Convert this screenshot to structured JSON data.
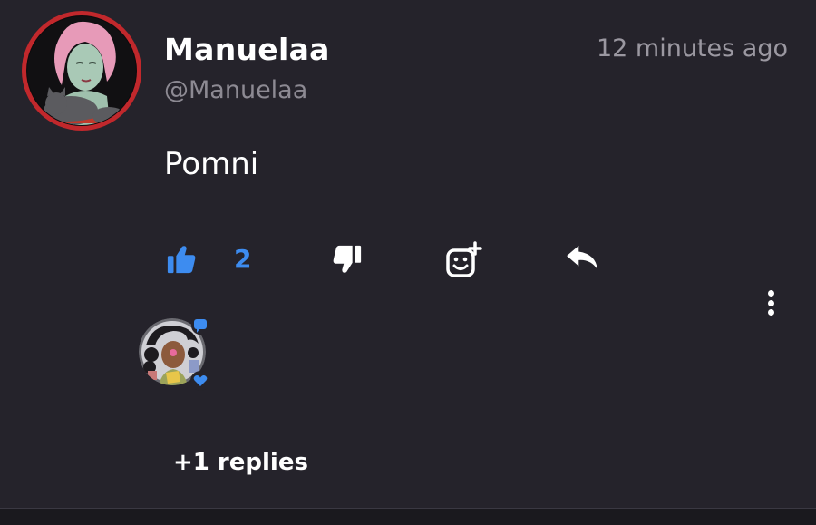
{
  "comment": {
    "author_name": "Manuelaa",
    "author_handle": "@Manuelaa",
    "timestamp": "12 minutes ago",
    "text": "Pomni",
    "likes": "2",
    "replies_link": "+1 replies"
  },
  "icons": {
    "like": "thumbs-up-icon",
    "dislike": "thumbs-down-icon",
    "react": "add-reaction-icon",
    "reply": "reply-arrow-icon",
    "more": "more-vertical-icon"
  },
  "colors": {
    "background": "#25232b",
    "accent_blue": "#3d8cf0",
    "text_primary": "#ffffff",
    "text_secondary": "#8d8a93",
    "avatar_ring": "#c1282c"
  }
}
